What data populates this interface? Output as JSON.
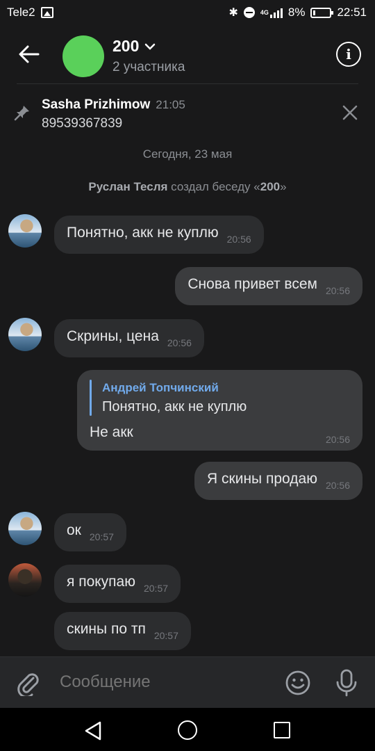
{
  "status_bar": {
    "carrier": "Tele2",
    "network": "4G",
    "battery": "8%",
    "time": "22:51"
  },
  "header": {
    "title": "200",
    "subtitle": "2 участника"
  },
  "pinned": {
    "author": "Sasha Prizhimow",
    "time": "21:05",
    "text": "89539367839"
  },
  "date_separator": "Сегодня, 23 мая",
  "service_message": {
    "author": "Руслан Тесля",
    "action": " создал беседу «",
    "chat": "200",
    "end": "»"
  },
  "messages": [
    {
      "text": "Понятно, акк не куплю",
      "time": "20:56"
    },
    {
      "text": "Снова привет всем",
      "time": "20:56"
    },
    {
      "text": "Скрины, цена",
      "time": "20:56"
    },
    {
      "reply_author": "Андрей Топчинский",
      "reply_text": "Понятно, акк не куплю",
      "text": "Не акк",
      "time": "20:56"
    },
    {
      "text": "Я скины продаю",
      "time": "20:56"
    },
    {
      "text": "ок",
      "time": "20:57"
    },
    {
      "text": "я покупаю",
      "time": "20:57"
    },
    {
      "text": "скины по тп",
      "time": "20:57"
    }
  ],
  "input": {
    "placeholder": "Сообщение"
  },
  "icons": {
    "back": "arrow-left-icon",
    "info": "info-icon",
    "pin": "pin-icon",
    "close": "close-icon",
    "attach": "paperclip-icon",
    "emoji": "smile-icon",
    "mic": "microphone-icon"
  },
  "colors": {
    "background": "#19191a",
    "bubble_in": "#2c2d2f",
    "bubble_out": "#3b3c3e",
    "accent": "#71aaeb",
    "chat_avatar": "#5ad05a"
  }
}
